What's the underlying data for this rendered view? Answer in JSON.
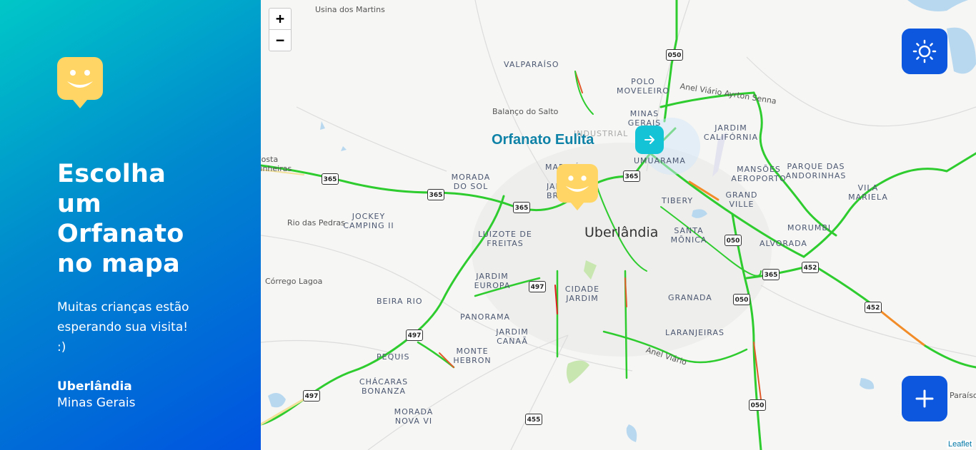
{
  "sidebar": {
    "headline": "Escolha um Orfanato no mapa",
    "subtitle": "Muitas crianças estão esperando sua visita! :)",
    "city": "Uberlândia",
    "state": "Minas Gerais",
    "logo_icon": "smiley-marker-logo-icon",
    "gradient_colors": [
      "#00c7c7",
      "#0053e0"
    ]
  },
  "map": {
    "zoom_in_label": "+",
    "zoom_out_label": "−",
    "attribution": "Leaflet",
    "popup": {
      "name": "Orfanato Eulita",
      "button_icon": "arrow-right-icon"
    },
    "theme_button_icon": "sun-icon",
    "add_button_icon": "plus-icon",
    "labels": {
      "usina": "Usina dos Martins",
      "valparaiso": "VALPARAÍSO",
      "polo": "POLO MOVELEIRO",
      "balanco": "Balanço do Salto",
      "minas_gerais": "MINAS GERAIS",
      "industrial": "INDUSTRIAL",
      "anel_ayrton": "Anel Viário Ayrton Senna",
      "jardim_california": "JARDIM CALIFÓRNIA",
      "umuarama": "UMUARAMA",
      "morada_sol": "MORADA DO SOL",
      "marajo": "MARAJÓ",
      "jardim_brasilia": "JARDIM BRASÍLIA",
      "mansoes": "MANSÕES AEROPORTO",
      "parque_andorinhas": "PARQUE DAS ANDORINHAS",
      "vila_mariela": "VILA MARIELA",
      "costa_pinheiras": "Costa Pinheiras",
      "jockey": "JOCKEY CAMPING II",
      "rio_pedras": "Rio das Pedras",
      "luizote": "LUIZOTE DE FREITAS",
      "uberlandia": "Uberlândia",
      "tibery": "TIBERY",
      "grand_ville": "GRAND VILLE",
      "santa_monica": "SANTA MÔNICA",
      "morumbi": "MORUMBI",
      "alvorada": "ALVORADA",
      "corrego": "Córrego Lagoa",
      "jardim_europa": "JARDIM EUROPA",
      "beira_rio": "BEIRA RIO",
      "cidade_jardim": "CIDADE JARDIM",
      "granada": "GRANADA",
      "panorama": "PANORAMA",
      "jardim_canaa": "JARDIM CANAÃ",
      "laranjeiras": "LARANJEIRAS",
      "pequis": "PEQUIS",
      "monte_hebron": "MONTE HEBRON",
      "anel_viario": "Anel Viário",
      "chacaras": "CHÁCARAS BONANZA",
      "morada_nova": "MORADA NOVA VI",
      "paraiso": "Paraíso"
    },
    "shields": {
      "s050a": "050",
      "s365a": "365",
      "s365b": "365",
      "s365c": "365",
      "s365d": "365",
      "s050b": "050",
      "s365e": "365",
      "s452a": "452",
      "s497a": "497",
      "s050c": "050",
      "s452b": "452",
      "s497b": "497",
      "s497c": "497",
      "s050d": "050",
      "s455": "455"
    }
  }
}
